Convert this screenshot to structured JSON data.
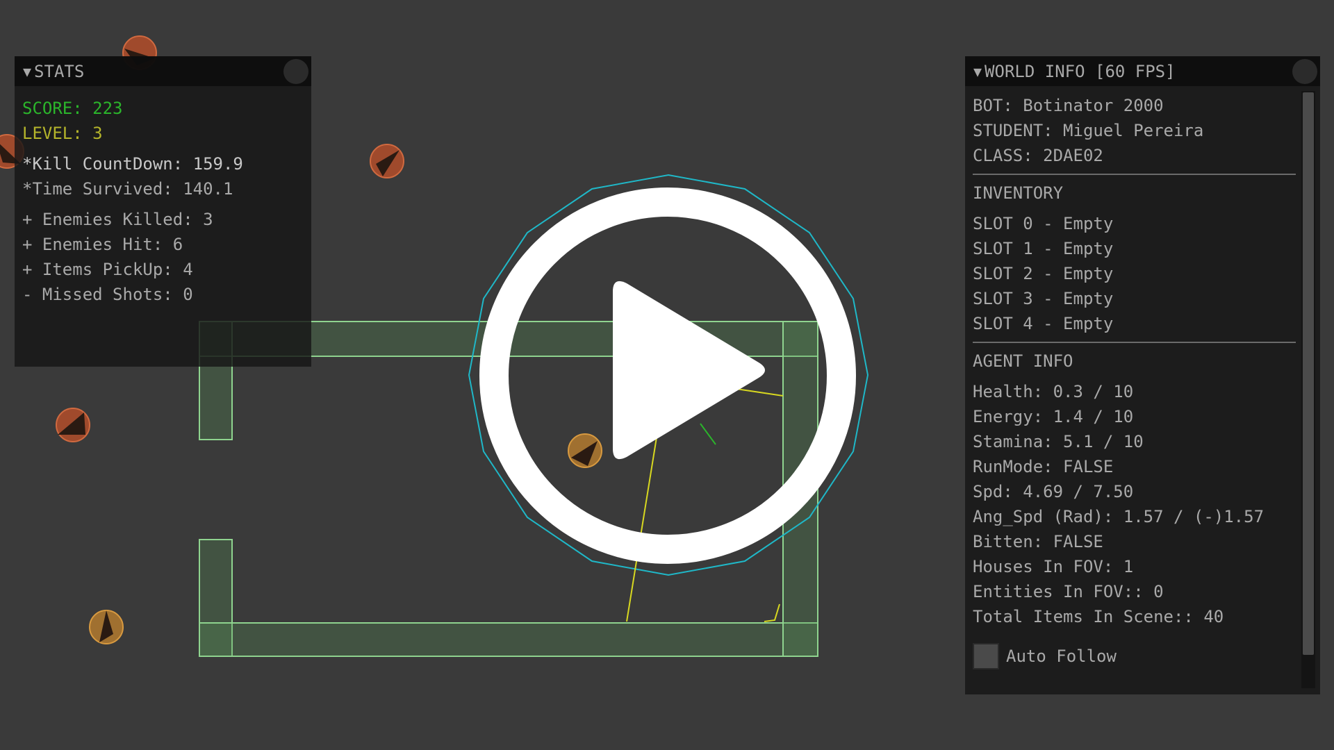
{
  "colors": {
    "background": "#3a3a3a",
    "panel_text": "#a9a9a9",
    "score_green": "#2bb52b",
    "level_yellow": "#b5b52b",
    "wall_outline": "#8fd48f",
    "wall_fill": "#3f5a3f",
    "fov_circle": "#1fb8c8",
    "enemy_red": "#b0502e",
    "enemy_orange": "#b07a2e",
    "ray_yellow": "#d8d820",
    "play_button": "#ffffff"
  },
  "stats_panel": {
    "title": "STATS",
    "collapse_icon": "triangle-down-icon",
    "score": "SCORE: 223",
    "level": "LEVEL: 3",
    "kill_countdown": "*Kill CountDown: 159.9",
    "time_survived": "*Time Survived: 140.1",
    "enemies_killed": "+ Enemies Killed: 3",
    "enemies_hit": "+ Enemies Hit: 6",
    "items_pickup": "+ Items PickUp: 4",
    "missed_shots": "- Missed Shots: 0"
  },
  "world_panel": {
    "title": "WORLD INFO [60 FPS]",
    "collapse_icon": "triangle-down-icon",
    "bot": "BOT: Botinator 2000",
    "student": "STUDENT: Miguel Pereira",
    "class": "CLASS: 2DAE02",
    "inventory_header": "INVENTORY",
    "inventory_slots": [
      "SLOT 0 - Empty",
      "SLOT 1 - Empty",
      "SLOT 2 - Empty",
      "SLOT 3 - Empty",
      "SLOT 4 - Empty"
    ],
    "agent_header": "AGENT INFO",
    "agent_info": [
      "Health: 0.3 / 10",
      "Energy: 1.4 / 10",
      "Stamina: 5.1 / 10",
      "RunMode: FALSE",
      "Spd: 4.69 / 7.50",
      "Ang_Spd (Rad): 1.57 / (-)1.57",
      "Bitten: FALSE",
      "Houses In FOV: 1",
      "Entities In FOV:: 0",
      "Total Items In Scene:: 40"
    ],
    "auto_follow_label": "Auto Follow"
  },
  "play_button": {
    "icon": "play-icon"
  }
}
